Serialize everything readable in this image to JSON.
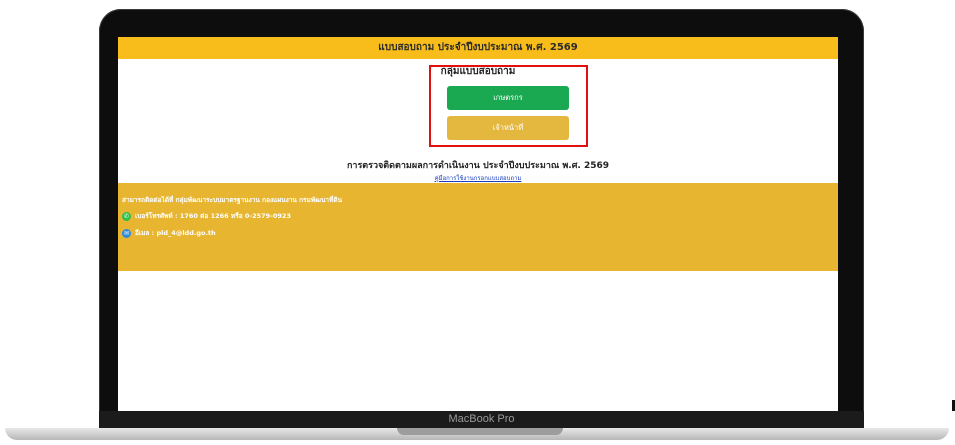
{
  "device": {
    "model_label": "MacBook Pro"
  },
  "page": {
    "title_bar": "แบบสอบถาม ประจำปีงบประมาณ พ.ศ. 2569",
    "group_title": "กลุ่มแบบสอบถาม",
    "buttons": {
      "farmer": "เกษตรกร",
      "officer": "เจ้าหน้าที่"
    },
    "monitoring_title": "การตรวจติดตามผลการดำเนินงาน ประจำปีงบประมาณ พ.ศ. 2569",
    "manual_link": "คู่มือการใช้งานกรอกแบบสอบถาม"
  },
  "contact": {
    "heading": "สามารถติดต่อได้ที่ กลุ่มพัฒนาระบบมาตรฐานงาน กองแผนงาน กรมพัฒนาที่ดิน",
    "phone": "เบอร์โทรศัพท์ : 1760 ต่อ 1266 หรือ 0-2579-0923",
    "email": "อีเมล : pld_4@ldd.go.th"
  },
  "colors": {
    "header_yellow": "#f8bd1a",
    "contact_yellow": "#e7b530",
    "farmer_green": "#1aa851",
    "officer_yellow": "#e4b73f",
    "highlight_red": "#e01010"
  },
  "icons": {
    "phone": "phone-icon",
    "email": "mail-icon"
  }
}
